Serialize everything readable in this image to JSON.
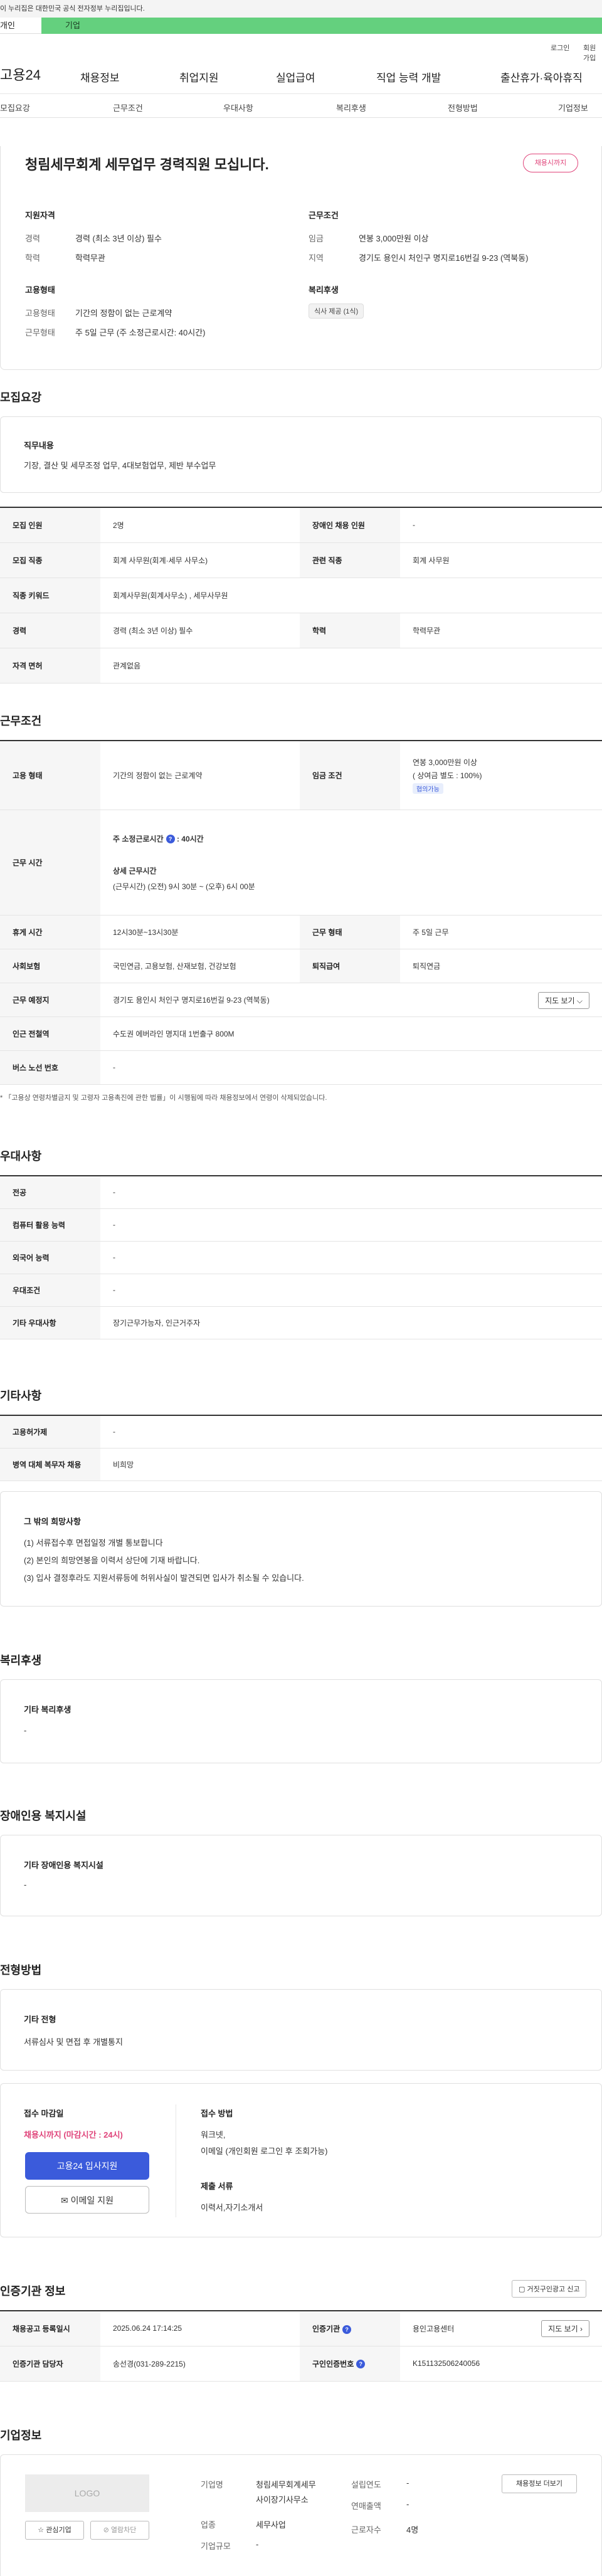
{
  "gov_bar": {
    "text": "이 누리집은 대한민국 공식 전자정부 누리집입니다."
  },
  "tabs": {
    "personal": "개인",
    "business": "기업"
  },
  "util": {
    "login": "로그인",
    "join": "회원가입"
  },
  "header": {
    "logo": "고용24",
    "menu": [
      "채용정보",
      "취업지원",
      "실업급여",
      "직업 능력 개발",
      "출산휴가·육아휴직"
    ]
  },
  "subnav": [
    "모집요강",
    "근무조건",
    "우대사항",
    "복리후생",
    "전형방법",
    "기업정보"
  ],
  "job": {
    "title": "청림세무회계 세무업무 경력직원 모십니다.",
    "badge": "채용시까지"
  },
  "summary": {
    "qual_title": "지원자격",
    "career_label": "경력",
    "career_value": "경력 (최소 3년 이상) 필수",
    "edu_label": "학력",
    "edu_value": "학력무관",
    "cond_title": "근무조건",
    "wage_label": "임금",
    "wage_value": "연봉 3,000만원 이상",
    "region_label": "지역",
    "region_value": "경기도 용인시 처인구 명지로16번길 9-23 (역북동)",
    "emp_title": "고용형태",
    "emp_label": "고용형태",
    "emp_value": "기간의 정함이 없는 근로계약",
    "work_label": "근무형태",
    "work_value": "주 5일 근무 (주 소정근로시간: 40시간)",
    "welfare_title": "복리후생",
    "welfare_tag": "식사 제공 (1식)"
  },
  "recruit": {
    "section": "모집요강",
    "duty_title": "직무내용",
    "duty_text": "기장, 결산 및 세무조정 업무, 4대보험업무, 제반 부수업무",
    "rows": [
      {
        "l1": "모집 인원",
        "v1": "2명",
        "l2": "장애인 채용 인원",
        "v2": "-"
      },
      {
        "l1": "모집 직종",
        "v1": "회계 사무원(회계·세무 사무소)",
        "l2": "관련 직종",
        "v2": "회계 사무원"
      },
      {
        "l1": "직종 키워드",
        "v1": "회계사무원(회계사무소) , 세무사무원",
        "l2": "",
        "v2": ""
      },
      {
        "l1": "경력",
        "v1": "경력 (최소 3년 이상) 필수",
        "l2": "학력",
        "v2": "학력무관"
      },
      {
        "l1": "자격 면허",
        "v1": "관계없음",
        "l2": "",
        "v2": ""
      }
    ]
  },
  "conditions": {
    "section": "근무조건",
    "emp_type_label": "고용 형태",
    "emp_type_value": "기간의 정함이 없는 근로계약",
    "wage_label": "임금 조건",
    "wage_value": "연봉 3,000만원 이상",
    "wage_bonus": "( 상여금 별도 : 100%)",
    "wage_pill": "협의가능",
    "hours_label": "근무 시간",
    "hours_weekly_label": "주 소정근로시간",
    "hours_weekly_value": ": 40시간",
    "hours_detail_title": "상세 근무시간",
    "hours_detail_text": "(근무시간) (오전) 9시 30분 ~ (오후) 6시 00분",
    "break_label": "휴게 시간",
    "break_value": "12시30분~13시30분",
    "work_form_label": "근무 형태",
    "work_form_value": "주 5일 근무",
    "insurance_label": "사회보험",
    "insurance_value": "국민연금, 고용보험, 산재보험, 건강보험",
    "severance_label": "퇴직급여",
    "severance_value": "퇴직연금",
    "location_label": "근무 예정지",
    "location_value": "경기도 용인시 처인구 명지로16번길 9-23 (역북동)",
    "map_button": "지도 보기 ⌵",
    "subway_label": "인근 전철역",
    "subway_value": "수도권 에버라인 명지대 1번출구 800M",
    "bus_label": "버스 노선 번호",
    "bus_value": "-",
    "note": "* 「고용상 연령차별금지 및 고령자 고용촉진에 관한 법률」이 시행됨에 따라 채용정보에서 연령이 삭제되었습니다."
  },
  "preference": {
    "section": "우대사항",
    "rows": [
      {
        "label": "전공",
        "value": "-"
      },
      {
        "label": "컴퓨터 활용 능력",
        "value": "-"
      },
      {
        "label": "외국어 능력",
        "value": "-"
      },
      {
        "label": "우대조건",
        "value": "-"
      },
      {
        "label": "기타 우대사항",
        "value": "장기근무가능자, 인근거주자"
      }
    ]
  },
  "etc": {
    "section": "기타사항",
    "rows": [
      {
        "label": "고용허가제",
        "value": "-"
      },
      {
        "label": "병역 대체 복무자 채용",
        "value": "비희망"
      }
    ],
    "box_title": "그 밖의 희망사항",
    "box_lines": [
      "(1)  서류접수후 면접일정 개별 통보합니다",
      "(2)  본인의 희망연봉을 이력서 상단에 기재 바랍니다.",
      "(3)  입사 결정후라도 지원서류등에 허위사실이 발견되면 입사가 취소될 수 있습니다."
    ]
  },
  "welfare": {
    "section": "복리후생",
    "box_title": "기타 복리후생",
    "box_value": "-"
  },
  "disability": {
    "section": "장애인용 복지시설",
    "box_title": "기타 장애인용 복지시설",
    "box_value": "-"
  },
  "selection": {
    "section": "전형방법",
    "box_title": "기타 전형",
    "box_value": "서류심사 및 면접 후 개별통지",
    "deadline_title": "접수 마감일",
    "deadline_value": "채용시까지 (마감시간 : 24시)",
    "apply_button": "고용24 입사지원",
    "email_button": "이메일 지원",
    "method_title": "접수 방법",
    "method_line1": "워크넷,",
    "method_line2": "이메일 (개인회원 로그인 후 조회가능)",
    "docs_title": "제출 서류",
    "docs_value": "이력서,자기소개서"
  },
  "certification": {
    "section": "인증기관 정보",
    "report_button": "거짓구인광고 신고",
    "reg_label": "채용공고 등록일시",
    "reg_value": "2025.06.24 17:14:25",
    "inst_label": "인증기관",
    "inst_value": "용인고용센터",
    "map_button": "지도 보기 ›",
    "manager_label": "인증기관 담당자",
    "manager_value": "송선경(031-289-2215)",
    "cert_no_label": "구인인증번호",
    "cert_no_value": "K151132506240056"
  },
  "company": {
    "section": "기업정보",
    "logo_text": "LOGO",
    "interest_button": "관심기업",
    "block_button": "열람차단",
    "name_label": "기업명",
    "name_value_1": "청림세무회계세무",
    "name_value_2": "사이장기사무소",
    "industry_label": "업종",
    "industry_value": "세무사업",
    "size_label": "기업규모",
    "size_value": "-",
    "founded_label": "설립연도",
    "founded_value": "-",
    "sales_label": "연매출액",
    "sales_value": "-",
    "employees_label": "근로자수",
    "employees_value": "4명",
    "recruit_info_button": "채용정보 더보기"
  }
}
